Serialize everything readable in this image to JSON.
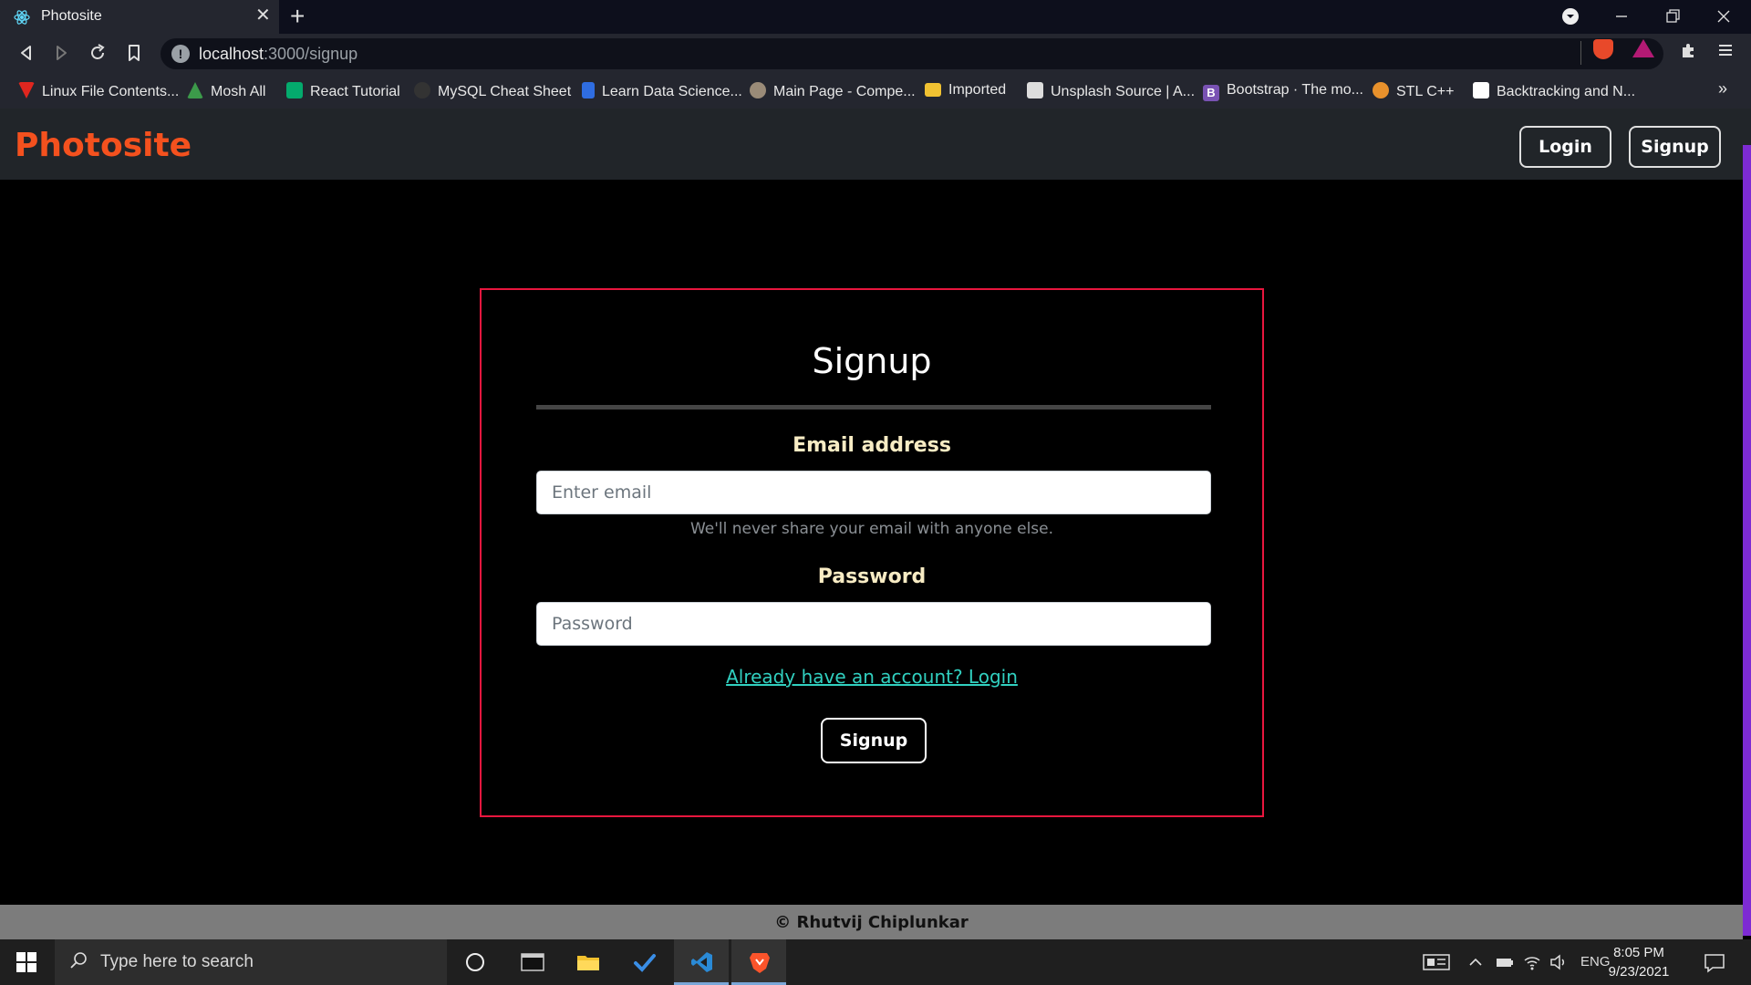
{
  "browser": {
    "tab_title": "Photosite",
    "tab_close": "✕",
    "new_tab": "+",
    "url_host": "localhost",
    "url_path": ":3000/signup",
    "bookmarks": [
      {
        "label": "Linux File Contents...",
        "icon": "linux-bookmark-icon",
        "color": "#e0261f"
      },
      {
        "label": "Mosh All",
        "icon": "google-drive-icon",
        "color": "#3c9a4a"
      },
      {
        "label": "React Tutorial",
        "icon": "w3schools-icon",
        "color": "#04aa6d"
      },
      {
        "label": "MySQL Cheat Sheet",
        "icon": "github-icon",
        "color": "#333333"
      },
      {
        "label": "Learn Data Science...",
        "icon": "docs-icon",
        "color": "#2f6de1"
      },
      {
        "label": "Main Page - Compe...",
        "icon": "wiki-icon",
        "color": "#9a8b78"
      },
      {
        "label": "Imported",
        "icon": "folder-icon",
        "color": "#f1c232"
      },
      {
        "label": "Unsplash Source | A...",
        "icon": "unsplash-icon",
        "color": "#ffffff"
      },
      {
        "label": "Bootstrap · The mo...",
        "icon": "bootstrap-icon",
        "color": "#7952b3"
      },
      {
        "label": "STL C++",
        "icon": "gfg-icon",
        "color": "#e8912c"
      },
      {
        "label": "Backtracking and N...",
        "icon": "leetcode-icon",
        "color": "#ffffff"
      }
    ],
    "bookmarks_overflow": "»"
  },
  "navbar": {
    "brand": "Photosite",
    "login_label": "Login",
    "signup_label": "Signup"
  },
  "form": {
    "title": "Signup",
    "email_label": "Email address",
    "email_placeholder": "Enter email",
    "email_help": "We'll never share your email with anyone else.",
    "password_label": "Password",
    "password_placeholder": "Password",
    "login_link": "Already have an account? Login",
    "submit_label": "Signup"
  },
  "footer": {
    "text": "© Rhutvij Chiplunkar"
  },
  "taskbar": {
    "search_placeholder": "Type here to search",
    "language": "ENG",
    "time": "8:05 PM",
    "date": "9/23/2021"
  },
  "colors": {
    "brand": "#f4511e",
    "card_border": "#e8163e",
    "link": "#31d0c0",
    "label": "#f8ecc4"
  }
}
